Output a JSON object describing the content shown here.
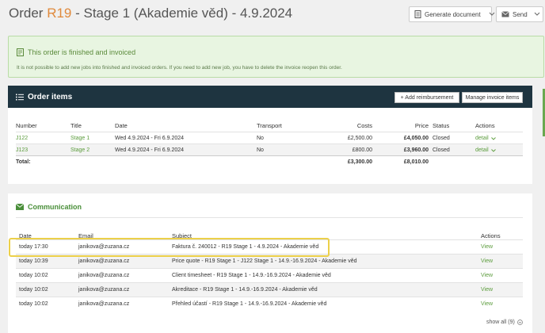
{
  "header": {
    "title_prefix": "Order ",
    "order_code": "R19",
    "title_suffix": " - Stage 1 (Akademie věd) - 4.9.2024",
    "generate_label": "Generate document",
    "send_label": "Send"
  },
  "notice": {
    "title": "This order is finished and invoiced",
    "text": "It is not possible to add new jobs into finished and invoiced orders. If you need to add new job, you have to delete the invoice reopen this order."
  },
  "order_items": {
    "title": "Order items",
    "add_reimbursement_label": "+ Add reimbursement",
    "manage_invoice_label": "Manage invoice items",
    "columns": [
      "Number",
      "Title",
      "Date",
      "Transport",
      "Costs",
      "Price",
      "Status",
      "Actions"
    ],
    "rows": [
      {
        "number": "J122",
        "title": "Stage 1",
        "date": "Wed 4.9.2024 - Fri 6.9.2024",
        "transport": "No",
        "costs": "£2,500.00",
        "price": "£4,050.00",
        "status": "Closed",
        "action": "detail"
      },
      {
        "number": "J123",
        "title": "Stage 2",
        "date": "Wed 4.9.2024 - Fri 6.9.2024",
        "transport": "No",
        "costs": "£800.00",
        "price": "£3,960.00",
        "status": "Closed",
        "action": "detail"
      }
    ],
    "total_label": "Total:",
    "total_costs": "£3,300.00",
    "total_price": "£8,010.00"
  },
  "communication": {
    "title": "Communication",
    "columns": [
      "Date",
      "Email",
      "Subject",
      "Actions"
    ],
    "rows": [
      {
        "date": "today 17:30",
        "email": "janikova@zuzana.cz",
        "subject": "Faktura č. 240012 - R19 Stage 1 - 4.9.2024 - Akademie věd",
        "action": "View"
      },
      {
        "date": "today 10:39",
        "email": "janikova@zuzana.cz",
        "subject": "Price quote - R19 Stage 1 - J122 Stage 1 - 14.9.-16.9.2024 - Akademie věd",
        "action": "View"
      },
      {
        "date": "today 10:02",
        "email": "janikova@zuzana.cz",
        "subject": "Client timesheet - R19 Stage 1 - 14.9.-16.9.2024 - Akademie věd",
        "action": "View"
      },
      {
        "date": "today 10:02",
        "email": "janikova@zuzana.cz",
        "subject": "Akreditace - R19 Stage 1 - 14.9.-16.9.2024 - Akademie věd",
        "action": "View"
      },
      {
        "date": "today 10:02",
        "email": "janikova@zuzana.cz",
        "subject": "Přehled účastí - R19 Stage 1 - 14.9.-16.9.2024 - Akademie věd",
        "action": "View"
      }
    ],
    "show_all_label": "show all (9)"
  },
  "colors": {
    "accent_green": "#5b9c3c",
    "header_dark": "#1e3440",
    "highlight": "#ecd04a",
    "order_code": "#e08a3c"
  }
}
